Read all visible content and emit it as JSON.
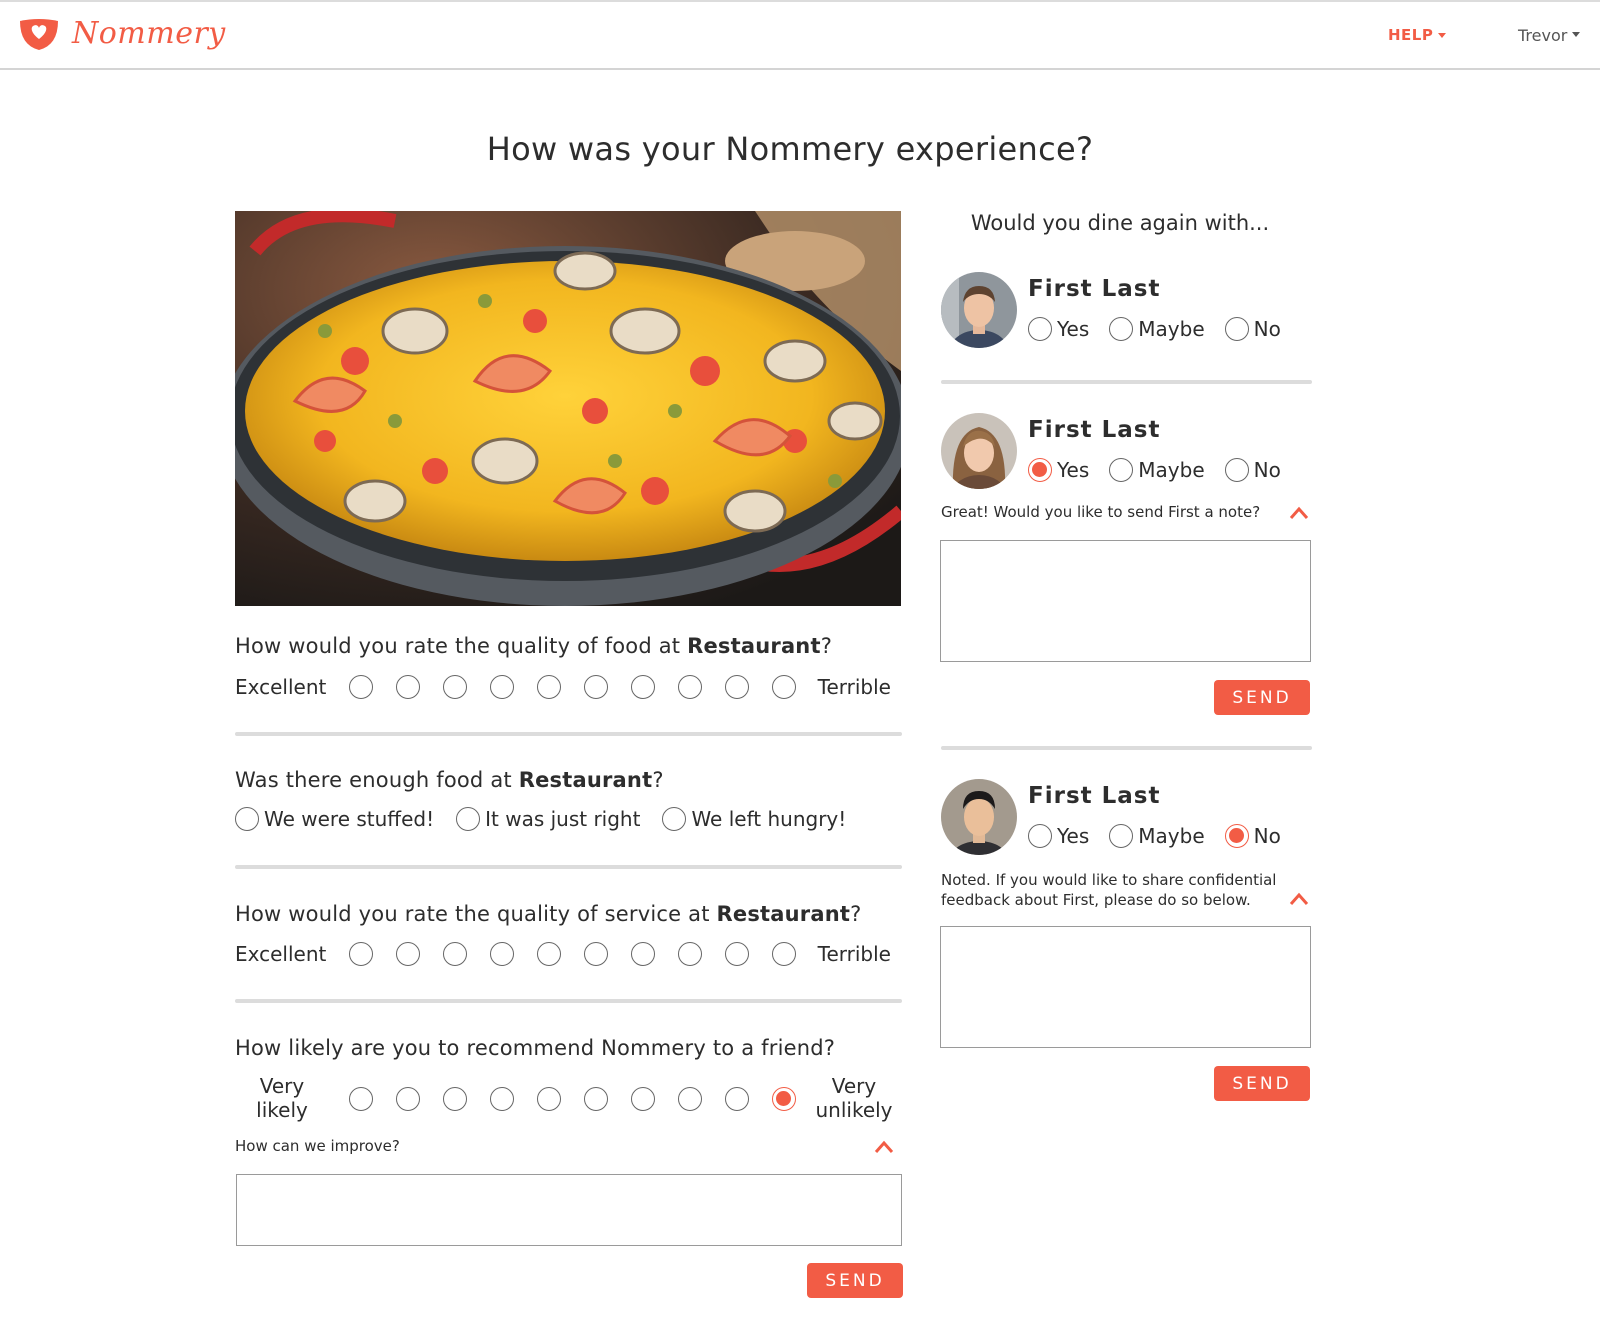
{
  "header": {
    "brand": "Nommery",
    "help_label": "HELP",
    "user_name": "Trevor"
  },
  "page": {
    "title": "How was your Nommery experience?"
  },
  "colors": {
    "accent": "#f25c45",
    "divider": "#dcdcdc",
    "text": "#2d2d2d"
  },
  "survey": {
    "food_quality": {
      "question": "How would you rate the quality of food at ",
      "restaurant": "Restaurant",
      "suffix": "?",
      "low_label": "Excellent",
      "high_label": "Terrible",
      "options_count": 10,
      "selected": null
    },
    "food_amount": {
      "question": "Was there enough food at ",
      "restaurant": "Restaurant",
      "suffix": "?",
      "options": [
        "We were stuffed!",
        "It was just right",
        "We left hungry!"
      ],
      "selected": null
    },
    "service_quality": {
      "question": "How would you rate the quality of service at ",
      "restaurant": "Restaurant",
      "suffix": "?",
      "low_label": "Excellent",
      "high_label": "Terrible",
      "options_count": 10,
      "selected": null
    },
    "recommend": {
      "question": "How likely are you to recommend Nommery to a friend?",
      "low_label_1": "Very",
      "low_label_2": "likely",
      "high_label_1": "Very",
      "high_label_2": "unlikely",
      "options_count": 10,
      "selected": 10,
      "followup_label": "How can we improve?",
      "textarea_value": "",
      "send_label": "SEND"
    }
  },
  "dine_again": {
    "title": "Would you dine again with...",
    "options": [
      "Yes",
      "Maybe",
      "No"
    ],
    "people": [
      {
        "name": "First Last",
        "avatar": "man-avatar",
        "selected": null
      },
      {
        "name": "First Last",
        "avatar": "woman-avatar",
        "selected": "Yes",
        "followup": "Great! Would you like to send First a note?",
        "textarea_value": "",
        "send_label": "SEND"
      },
      {
        "name": "First Last",
        "avatar": "man-avatar-2",
        "selected": "No",
        "followup_line1": "Noted. If you would like to share confidential",
        "followup_line2": "feedback about First, please do so below.",
        "textarea_value": "",
        "send_label": "SEND"
      }
    ]
  }
}
